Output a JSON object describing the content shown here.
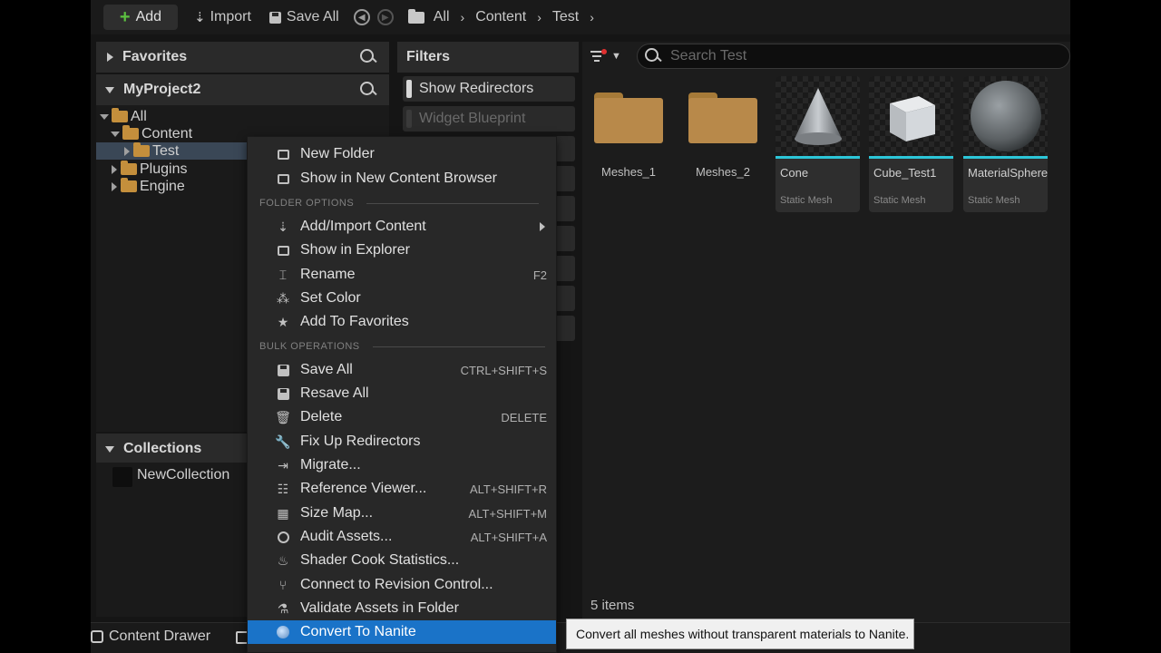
{
  "toolbar": {
    "add_label": "Add",
    "import_label": "Import",
    "save_all_label": "Save All",
    "breadcrumbs": [
      "All",
      "Content",
      "Test"
    ]
  },
  "favorites": {
    "title": "Favorites"
  },
  "project": {
    "title": "MyProject2",
    "tree": [
      {
        "label": "All",
        "expanded": true,
        "selected": false
      },
      {
        "label": "Content",
        "expanded": true,
        "selected": false
      },
      {
        "label": "Test",
        "expanded": false,
        "selected": true
      },
      {
        "label": "Plugins",
        "expanded": false,
        "selected": false
      },
      {
        "label": "Engine",
        "expanded": false,
        "selected": false
      }
    ]
  },
  "collections": {
    "title": "Collections",
    "items": [
      "NewCollection"
    ]
  },
  "filters": {
    "title": "Filters",
    "items": [
      {
        "label": "Show Redirectors",
        "enabled": true
      },
      {
        "label": "Widget Blueprint",
        "enabled": false
      }
    ]
  },
  "search": {
    "placeholder": "Search Test"
  },
  "assets": {
    "folders": [
      "Meshes_1",
      "Meshes_2"
    ],
    "items": [
      {
        "name": "Cone",
        "type": "Static Mesh",
        "icon": "cone-mesh-icon"
      },
      {
        "name": "Cube_Test1",
        "type": "Static Mesh",
        "icon": "cube-mesh-icon"
      },
      {
        "name": "MaterialSphere",
        "type": "Static Mesh",
        "icon": "sphere-mesh-icon"
      }
    ],
    "count_label": "5 items"
  },
  "statusbar": {
    "drawer_label": "Content Drawer"
  },
  "context_menu": {
    "items_top": [
      {
        "label": "New Folder",
        "icon": "new-folder-icon"
      },
      {
        "label": "Show in New Content Browser",
        "icon": "content-browser-icon"
      }
    ],
    "section_folder": "FOLDER OPTIONS",
    "items_folder": [
      {
        "label": "Add/Import Content",
        "icon": "import-icon",
        "submenu": true
      },
      {
        "label": "Show in Explorer",
        "icon": "explorer-icon"
      },
      {
        "label": "Rename",
        "icon": "rename-icon",
        "shortcut": "F2"
      },
      {
        "label": "Set Color",
        "icon": "color-icon"
      },
      {
        "label": "Add To Favorites",
        "icon": "star-icon"
      }
    ],
    "section_bulk": "BULK OPERATIONS",
    "items_bulk": [
      {
        "label": "Save All",
        "icon": "save-icon",
        "shortcut": "CTRL+SHIFT+S"
      },
      {
        "label": "Resave All",
        "icon": "resave-icon"
      },
      {
        "label": "Delete",
        "icon": "trash-icon",
        "shortcut": "DELETE"
      },
      {
        "label": "Fix Up Redirectors",
        "icon": "wrench-icon"
      },
      {
        "label": "Migrate...",
        "icon": "migrate-icon"
      },
      {
        "label": "Reference Viewer...",
        "icon": "reference-icon",
        "shortcut": "ALT+SHIFT+R"
      },
      {
        "label": "Size Map...",
        "icon": "size-map-icon",
        "shortcut": "ALT+SHIFT+M"
      },
      {
        "label": "Audit Assets...",
        "icon": "audit-icon",
        "shortcut": "ALT+SHIFT+A"
      },
      {
        "label": "Shader Cook Statistics...",
        "icon": "shader-icon"
      },
      {
        "label": "Connect to Revision Control...",
        "icon": "revision-control-icon"
      },
      {
        "label": "Validate Assets in Folder",
        "icon": "validate-icon"
      },
      {
        "label": "Convert To Nanite",
        "icon": "nanite-icon",
        "highlighted": true
      }
    ]
  },
  "tooltip": {
    "text": "Convert all meshes without transparent materials to Nanite."
  },
  "colors": {
    "accent_blue": "#1a73c8",
    "asset_underline": "#2cc6d8",
    "folder": "#b8894a",
    "add_plus": "#5cc040"
  }
}
